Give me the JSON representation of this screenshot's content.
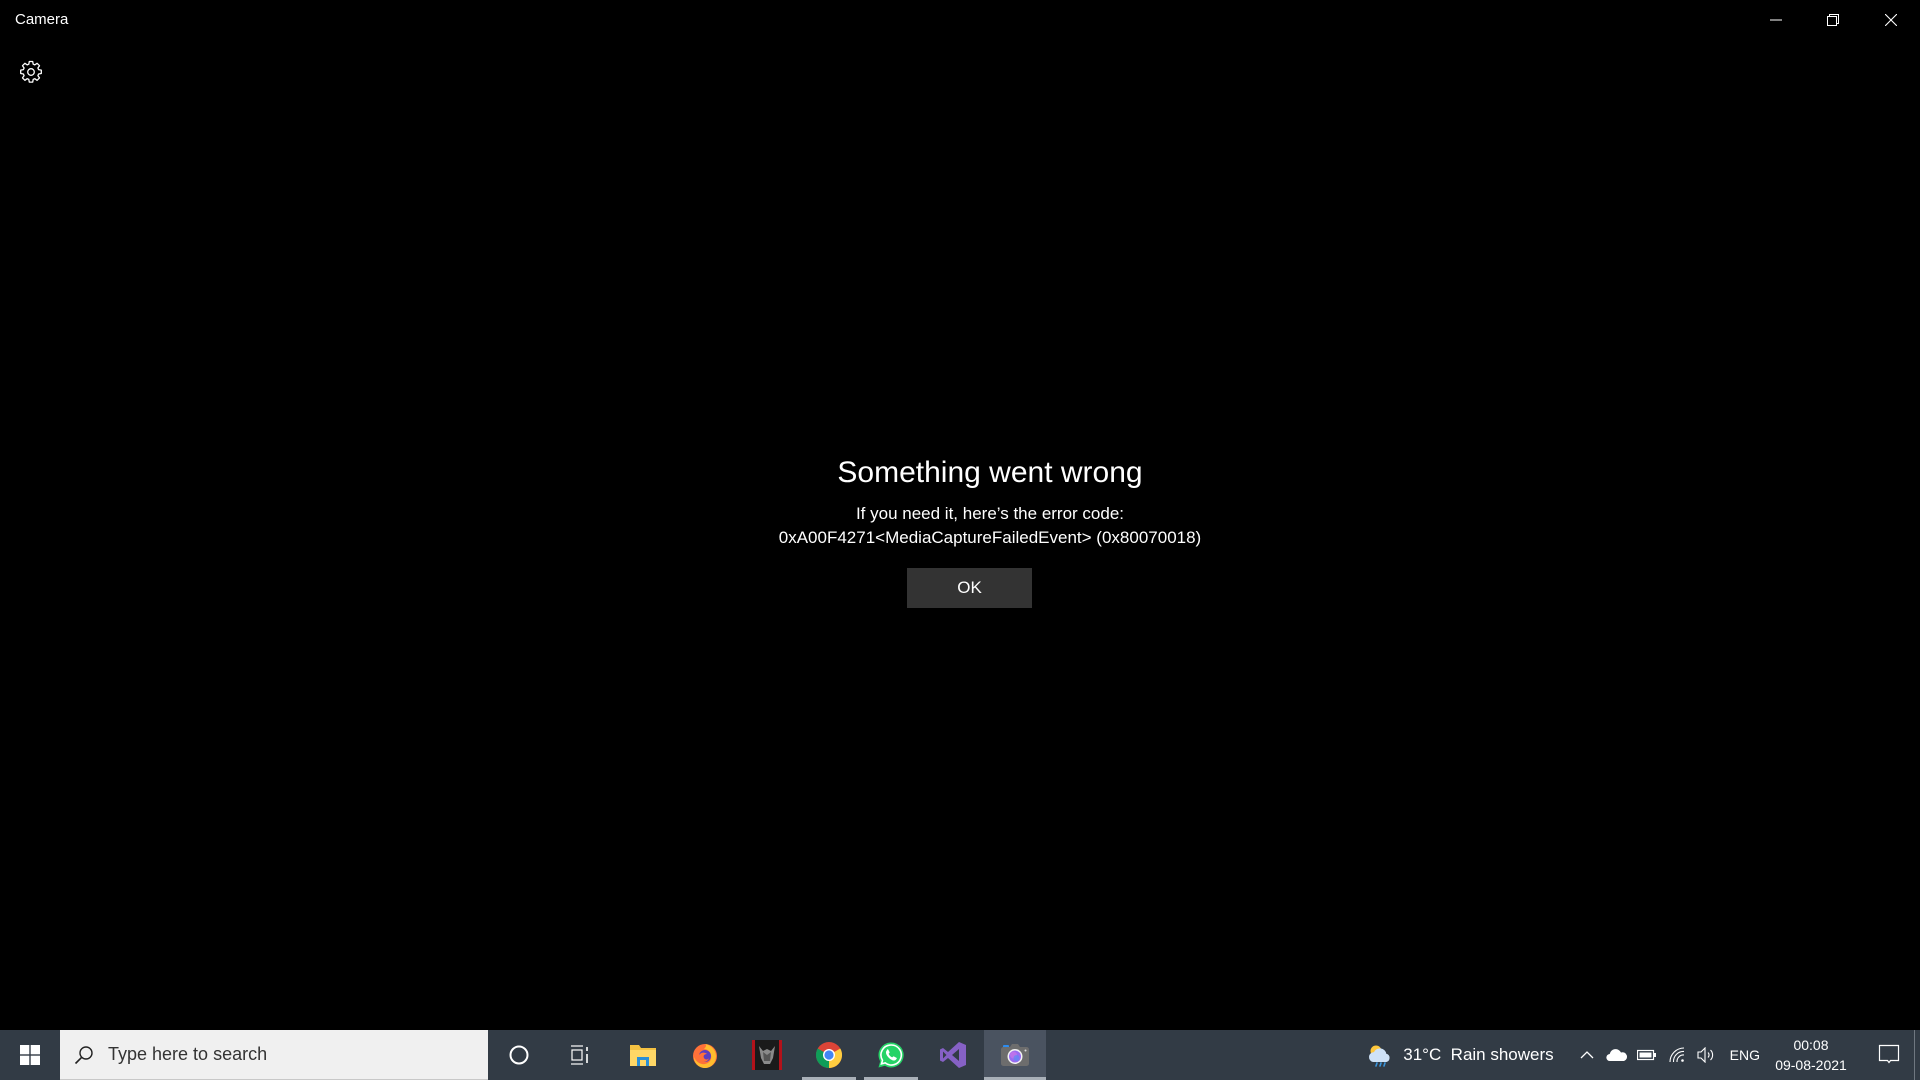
{
  "window": {
    "title": "Camera",
    "controls": {
      "minimize": "minimize-icon",
      "maximize": "restore-icon",
      "close": "close-icon"
    }
  },
  "toolbar": {
    "settings_icon": "gear-icon"
  },
  "error": {
    "title": "Something went wrong",
    "subtitle": "If you need it, here’s the error code:",
    "code": "0xA00F4271<MediaCaptureFailedEvent> (0x80070018)",
    "ok_label": "OK"
  },
  "taskbar": {
    "start_icon": "windows-logo-icon",
    "search": {
      "placeholder": "Type here to search",
      "icon": "search-icon"
    },
    "buttons": [
      {
        "name": "cortana",
        "icon": "cortana-circle-icon",
        "running": false,
        "active": false
      },
      {
        "name": "task-view",
        "icon": "task-view-icon",
        "running": false,
        "active": false
      },
      {
        "name": "file-explorer",
        "icon": "folder-icon",
        "running": false,
        "active": false
      },
      {
        "name": "firefox",
        "icon": "firefox-icon",
        "running": false,
        "active": false
      },
      {
        "name": "predator-sense",
        "icon": "predator-icon",
        "running": false,
        "active": false
      },
      {
        "name": "chrome",
        "icon": "chrome-icon",
        "running": true,
        "active": false
      },
      {
        "name": "whatsapp",
        "icon": "whatsapp-icon",
        "running": true,
        "active": false
      },
      {
        "name": "visual-studio",
        "icon": "visual-studio-icon",
        "running": false,
        "active": false
      },
      {
        "name": "camera",
        "icon": "camera-icon",
        "running": true,
        "active": true
      }
    ],
    "weather": {
      "icon": "cloud-rain-sun-icon",
      "text": "31°C  Rain showers"
    },
    "tray": {
      "chevron": "chevron-up-icon",
      "onedrive": "onedrive-cloud-icon",
      "battery": "battery-icon",
      "wifi": "wifi-icon",
      "volume": "volume-icon",
      "language": "ENG"
    },
    "clock": {
      "time": "00:08",
      "date": "09-08-2021"
    },
    "notifications_icon": "action-center-icon"
  },
  "colors": {
    "background": "#000000",
    "button_bg": "#333333",
    "taskbar_bg": "#323b45",
    "search_bg": "#f0f0f0"
  }
}
